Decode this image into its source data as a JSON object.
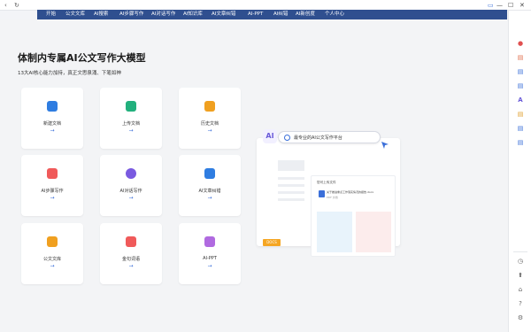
{
  "browser": {
    "back_icon": "‹",
    "refresh_icon": "↻",
    "window_controls": [
      "▭",
      "—",
      "☐",
      "✕"
    ]
  },
  "menu": [
    "开始",
    "公文文库",
    "AI搜索",
    "AI步骤写作",
    "AI对话写作",
    "AI知识库",
    "AI文章纠错",
    "AI-PPT",
    "AI纠错",
    "AI新创度",
    "个人中心"
  ],
  "hero": {
    "title": "体制内专属AI公文写作大模型",
    "subtitle": "13大AI核心能力加持，真正文思泉涌、下笔如神"
  },
  "cards": [
    {
      "label": "新建文档",
      "arrow": "→",
      "color": "#2f7de1"
    },
    {
      "label": "上传文档",
      "arrow": "→",
      "color": "#22b07d"
    },
    {
      "label": "历史文档",
      "arrow": "→",
      "color": "#f0a020"
    },
    {
      "label": "AI步骤写作",
      "arrow": "→",
      "color": "#f05a5a"
    },
    {
      "label": "AI对话写作",
      "arrow": "→",
      "color": "#7a5ae0"
    },
    {
      "label": "AI文章纠错",
      "arrow": "→",
      "color": "#2f7de1"
    },
    {
      "label": "公文文库",
      "arrow": "→",
      "color": "#f0a020"
    },
    {
      "label": "金句词语",
      "arrow": "→",
      "color": "#f05a5a"
    },
    {
      "label": "AI-PPT",
      "arrow": "→",
      "color": "#b06ae0"
    }
  ],
  "illustration": {
    "badge": "AI",
    "search_text": "最专业的AI公文写作平台",
    "inner_title": "您可上传文件",
    "file_name": "关于推进重点工作落实情况的报告.docx",
    "file_meta": "PDF 文档",
    "tag": "DOCS"
  },
  "sidebar": {
    "icons": [
      "avatar",
      "doc",
      "doc",
      "doc",
      "AI",
      "doc",
      "doc",
      "doc",
      "clock",
      "upload",
      "home",
      "help",
      "settings"
    ]
  }
}
